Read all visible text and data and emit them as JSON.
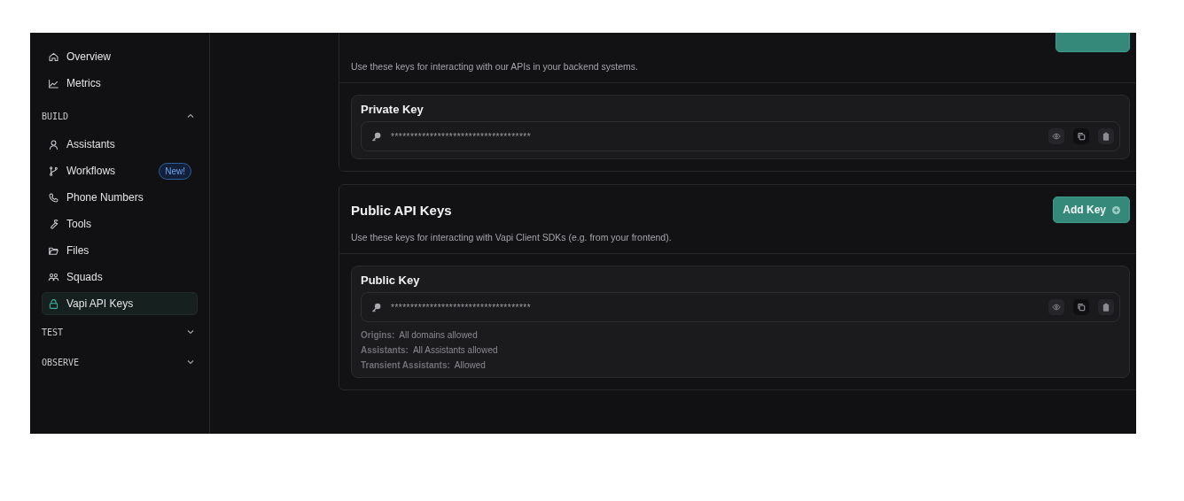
{
  "sidebar": {
    "items": [
      {
        "kind": "link",
        "label": "Overview",
        "selected": false
      },
      {
        "kind": "link",
        "label": "Metrics",
        "selected": false
      },
      {
        "kind": "group",
        "label": "BUILD",
        "expanded": true,
        "children": [
          {
            "label": "Assistants",
            "selected": false
          },
          {
            "label": "Workflows",
            "selected": false,
            "badge": "New!"
          },
          {
            "label": "Phone Numbers",
            "selected": false
          },
          {
            "label": "Tools",
            "selected": false
          },
          {
            "label": "Files",
            "selected": false
          },
          {
            "label": "Squads",
            "selected": false
          },
          {
            "label": "Vapi API Keys",
            "selected": true
          }
        ]
      },
      {
        "kind": "group",
        "label": "TEST",
        "expanded": false
      },
      {
        "kind": "group",
        "label": "OBSERVE",
        "expanded": false
      }
    ]
  },
  "sections": [
    {
      "kind": "cut",
      "description": "Use these keys for interacting with our APIs in your backend systems.",
      "key": {
        "title": "Private Key",
        "value": "************************************"
      }
    },
    {
      "kind": "full",
      "title": "Public API Keys",
      "button": "Add Key",
      "description": "Use these keys for interacting with Vapi Client SDKs (e.g. from your frontend).",
      "key": {
        "title": "Public Key",
        "value": "************************************",
        "details": [
          {
            "label": "Origins:",
            "value": "All domains allowed"
          },
          {
            "label": "Assistants:",
            "value": "All Assistants allowed"
          },
          {
            "label": "Transient Assistants:",
            "value": "Allowed"
          }
        ]
      }
    }
  ]
}
